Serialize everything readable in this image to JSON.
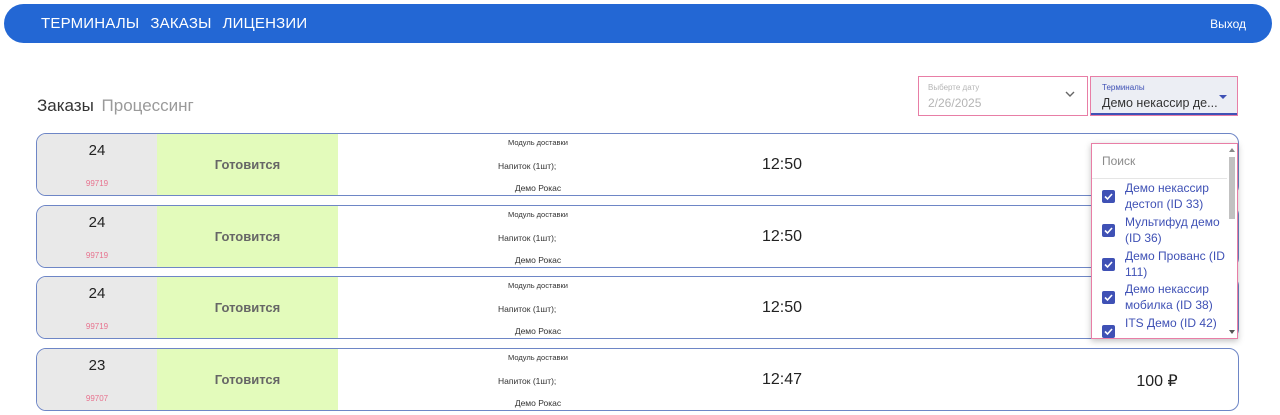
{
  "nav": {
    "links": [
      "ТЕРМИНАЛЫ",
      "ЗАКАЗЫ",
      "ЛИЦЕНЗИИ"
    ],
    "logout": "Выход",
    "color": "#2367d4"
  },
  "page": {
    "title": "Заказы",
    "subtitle": "Процессинг"
  },
  "filters": {
    "date": {
      "label": "Выберте дату",
      "value": "2/26/2025"
    },
    "terminals": {
      "label": "Терминалы",
      "value": "Демо некассир де..."
    }
  },
  "orders": [
    {
      "number": "24",
      "code": "99719",
      "status": "Готовится",
      "module": "Модуль доставки",
      "item": "Напиток (1шт);",
      "client": "Демо Рокас",
      "time": "12:50",
      "price": ""
    },
    {
      "number": "24",
      "code": "99719",
      "status": "Готовится",
      "module": "Модуль доставки",
      "item": "Напиток (1шт);",
      "client": "Демо Рокас",
      "time": "12:50",
      "price": ""
    },
    {
      "number": "24",
      "code": "99719",
      "status": "Готовится",
      "module": "Модуль доставки",
      "item": "Напиток (1шт);",
      "client": "Демо Рокас",
      "time": "12:50",
      "price": ""
    },
    {
      "number": "23",
      "code": "99707",
      "status": "Готовится",
      "module": "Модуль доставки",
      "item": "Напиток (1шт);",
      "client": "Демо Рокас",
      "time": "12:47",
      "price": "100 ₽"
    }
  ],
  "dropdown": {
    "search_placeholder": "Поиск",
    "options": [
      {
        "label": "Демо некассир дестоп (ID 33)",
        "checked": true
      },
      {
        "label": "Мультифуд демо (ID 36)",
        "checked": true
      },
      {
        "label": "Демо Прованс (ID 111)",
        "checked": true
      },
      {
        "label": "Демо некассир мобилка (ID 38)",
        "checked": true
      },
      {
        "label": "ITS Демо (ID 42)",
        "checked": true
      }
    ]
  },
  "colors": {
    "status_bg": "#e3fbbb",
    "code_text": "#e8738f",
    "accent": "#3f51b5",
    "focus_border": "#e87ea6"
  }
}
